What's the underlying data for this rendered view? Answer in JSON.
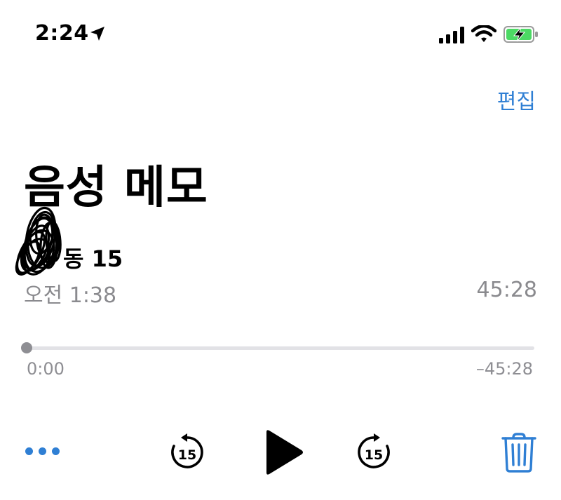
{
  "status_bar": {
    "time": "2:24",
    "icons": [
      "location-arrow-icon",
      "cellular-signal-icon",
      "wifi-icon",
      "battery-charging-icon"
    ]
  },
  "nav": {
    "edit_label": "편집"
  },
  "page": {
    "title": "음성 메모"
  },
  "recording": {
    "title": "동 15",
    "date": "오전 1:38",
    "duration": "45:28",
    "progress": 0
  },
  "scrubber": {
    "elapsed": "0:00",
    "remaining": "–45:28"
  },
  "controls": {
    "skip_back_seconds": "15",
    "skip_forward_seconds": "15",
    "icons": [
      "more-icon",
      "skip-back-15-icon",
      "play-icon",
      "skip-forward-15-icon",
      "trash-icon"
    ]
  },
  "colors": {
    "accent": "#2f7fd4",
    "secondary_text": "#8a8a8e",
    "battery_green": "#4cd964"
  }
}
